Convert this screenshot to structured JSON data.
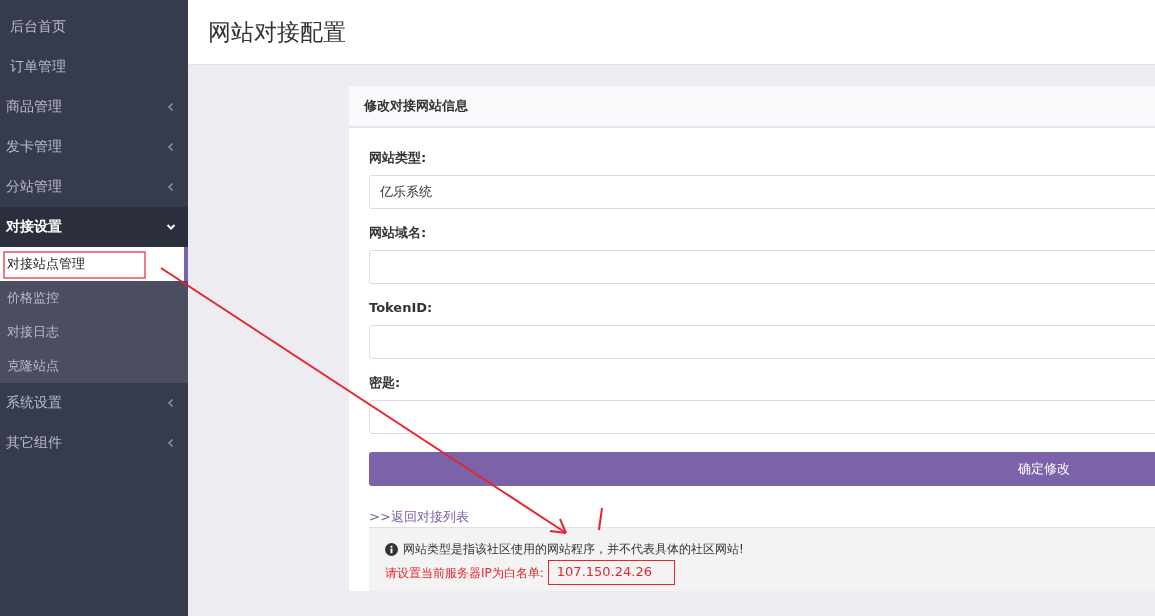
{
  "sidebar": {
    "items": [
      {
        "label": "后台首页",
        "kind": "link"
      },
      {
        "label": "订单管理",
        "kind": "link"
      },
      {
        "label": "商品管理",
        "kind": "menu",
        "expanded": false
      },
      {
        "label": "发卡管理",
        "kind": "menu",
        "expanded": false
      },
      {
        "label": "分站管理",
        "kind": "menu",
        "expanded": false
      },
      {
        "label": "对接设置",
        "kind": "menu",
        "expanded": true,
        "children": [
          {
            "label": "对接站点管理",
            "selected": true
          },
          {
            "label": "价格监控",
            "selected": false
          },
          {
            "label": "对接日志",
            "selected": false
          },
          {
            "label": "克隆站点",
            "selected": false
          }
        ]
      },
      {
        "label": "系统设置",
        "kind": "menu",
        "expanded": false
      },
      {
        "label": "其它组件",
        "kind": "menu",
        "expanded": false
      }
    ]
  },
  "page": {
    "title": "网站对接配置"
  },
  "card": {
    "title": "修改对接网站信息",
    "fields": [
      {
        "label": "网站类型:",
        "value": "亿乐系统"
      },
      {
        "label": "网站域名:"
      },
      {
        "label": "TokenID:"
      },
      {
        "label": "密匙:"
      }
    ],
    "submit": "确定修改",
    "back_link": ">>返回对接列表",
    "notice": {
      "info": "网站类型是指该社区使用的网站程序，并不代表具体的社区网站!",
      "whitelist_label": "请设置当前服务器IP为白名单:",
      "ip": "107.150.24.26"
    }
  }
}
